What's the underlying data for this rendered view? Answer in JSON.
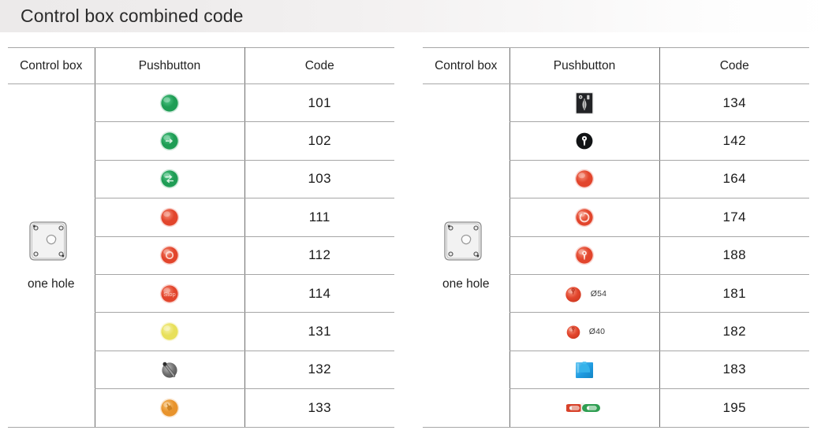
{
  "header": {
    "title": "Control box combined code"
  },
  "columns": {
    "control_box": "Control box",
    "pushbutton": "Pushbutton",
    "code": "Code"
  },
  "control_box_cell": {
    "caption": "one hole",
    "icon": "control-box-one-hole-icon"
  },
  "colors": {
    "green": "#1f9d55",
    "green_light": "#53c98a",
    "red": "#e2452c",
    "red_light": "#f5907a",
    "yellow": "#e8e05a",
    "yellow_light": "#f6f2a8",
    "orange": "#e8932c",
    "orange_light": "#f7c478",
    "gray": "#6f6f6f",
    "gray_light": "#bdbdbd",
    "blue": "#1e9ae0",
    "blue_light": "#64c6f2",
    "black": "#1a1a1a",
    "rule": "#a6a6a6",
    "rule_vertical": "#6d6d6d",
    "title_bg_from": "#eceaea",
    "title_bg_to": "#ffffff"
  },
  "left_table": {
    "rows": [
      {
        "icon": "green-round-pushbutton-plain-icon",
        "glyph": "",
        "dia": "",
        "code": "101"
      },
      {
        "icon": "green-round-pushbutton-arrow-icon",
        "glyph": "→",
        "dia": "",
        "code": "102"
      },
      {
        "icon": "green-round-pushbutton-double-arrow-icon",
        "glyph": "⇄",
        "dia": "",
        "code": "103"
      },
      {
        "icon": "red-round-pushbutton-plain-icon",
        "glyph": "",
        "dia": "",
        "code": "111"
      },
      {
        "icon": "red-round-pushbutton-ring-icon",
        "glyph": "O",
        "dia": "",
        "code": "112"
      },
      {
        "icon": "red-round-pushbutton-stop-icon",
        "glyph": "Stop",
        "dia": "",
        "code": "114"
      },
      {
        "icon": "yellow-round-pushbutton-plain-icon",
        "glyph": "",
        "dia": "",
        "code": "131"
      },
      {
        "icon": "gray-selector-switch-icon",
        "glyph": "",
        "dia": "",
        "code": "132"
      },
      {
        "icon": "orange-knob-pushbutton-icon",
        "glyph": "",
        "dia": "",
        "code": "133"
      }
    ]
  },
  "right_table": {
    "rows": [
      {
        "icon": "black-square-lever-switch-icon",
        "glyph": "",
        "dia": "",
        "code": "134"
      },
      {
        "icon": "black-key-switch-icon",
        "glyph": "",
        "dia": "",
        "code": "142"
      },
      {
        "icon": "red-mushroom-pushbutton-plain-icon",
        "glyph": "",
        "dia": "",
        "code": "164"
      },
      {
        "icon": "red-mushroom-pushbutton-ring-icon",
        "glyph": "",
        "dia": "",
        "code": "174"
      },
      {
        "icon": "red-mushroom-key-release-icon",
        "glyph": "",
        "dia": "",
        "code": "188"
      },
      {
        "icon": "red-emergency-stop-54-icon",
        "glyph": "",
        "dia": "Ø54",
        "code": "181"
      },
      {
        "icon": "red-emergency-stop-40-icon",
        "glyph": "",
        "dia": "Ø40",
        "code": "182"
      },
      {
        "icon": "blue-square-palm-pushbutton-icon",
        "glyph": "",
        "dia": "",
        "code": "183"
      },
      {
        "icon": "red-green-dual-pushbutton-icon",
        "glyph": "",
        "dia": "",
        "code": "195"
      }
    ]
  }
}
